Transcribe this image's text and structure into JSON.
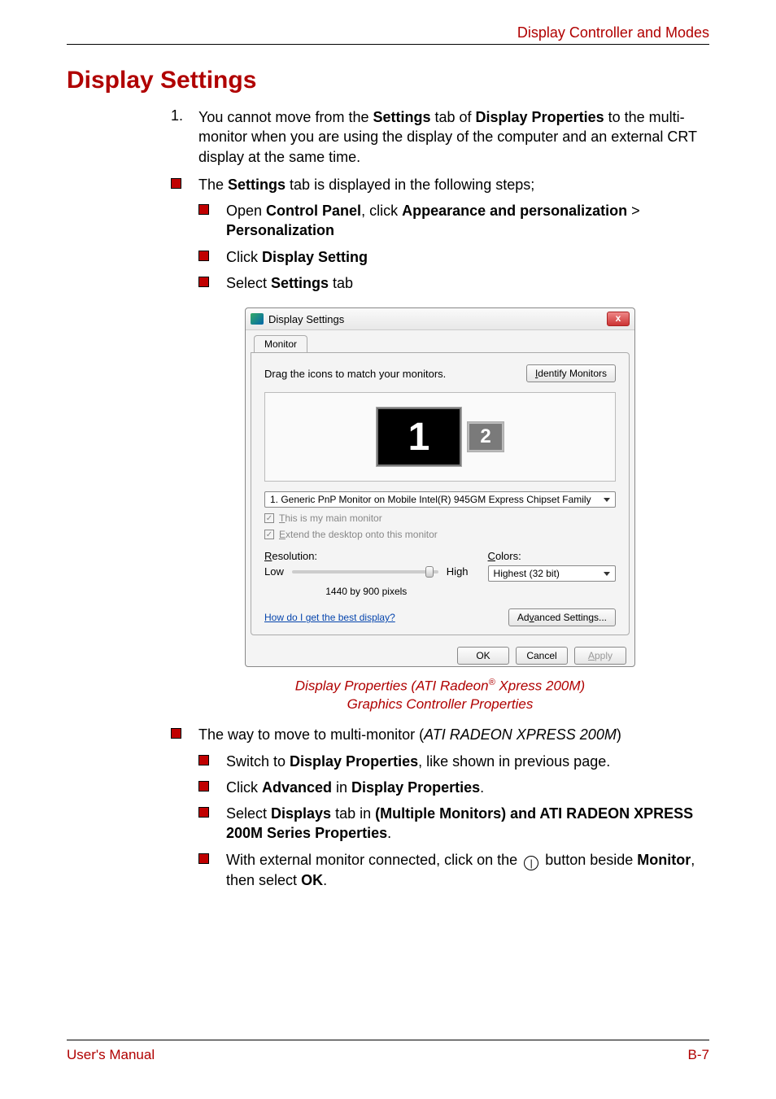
{
  "header": {
    "section_title": "Display Controller and Modes"
  },
  "title": "Display Settings",
  "item1": {
    "num": "1.",
    "p1a": "You cannot move from the ",
    "p1b": "Settings",
    "p1c": " tab of ",
    "p1d": "Display Properties",
    "p1e": " to the multi-monitor when you are using the display of the computer and an external CRT display at the same time."
  },
  "bullet1": {
    "a": "The ",
    "b": "Settings",
    "c": " tab is displayed in the following steps;"
  },
  "sub1": {
    "a": "Open ",
    "b": "Control Panel",
    "c": ", click ",
    "d": "Appearance and personalization",
    "e": " > ",
    "f": "Personalization"
  },
  "sub2": {
    "a": "Click ",
    "b": "Display Setting"
  },
  "sub3": {
    "a": "Select ",
    "b": "Settings",
    "c": " tab"
  },
  "dialog": {
    "title": "Display Settings",
    "close": "x",
    "tab": "Monitor",
    "drag_text": "Drag the icons to match your monitors.",
    "identify": "Identify Monitors",
    "mon1": "1",
    "mon2": "2",
    "monitor_select": "1. Generic PnP Monitor on Mobile Intel(R) 945GM Express Chipset Family",
    "check1_pre": "T",
    "check1_rest": "his is my main monitor",
    "check2_pre": "E",
    "check2_rest": "xtend the desktop onto this monitor",
    "res_label_pre": "R",
    "res_label_rest": "esolution:",
    "colors_label_pre": "C",
    "colors_label_rest": "olors:",
    "low": "Low",
    "high": "High",
    "res_value": "1440 by 900 pixels",
    "color_depth": "Highest (32 bit)",
    "help": "How do I get the best display?",
    "adv_pre": "Ad",
    "adv_u": "v",
    "adv_post": "anced Settings...",
    "ok": "OK",
    "cancel": "Cancel",
    "apply_pre": "A",
    "apply_rest": "pply"
  },
  "caption": {
    "line1a": "Display Properties (ATI Radeon",
    "reg": "®",
    "line1b": " Xpress 200M)",
    "line2": "Graphics Controller Properties"
  },
  "bullet2": {
    "a": "The way to move to multi-monitor (",
    "b": "ATI RADEON XPRESS 200M",
    "c": ")"
  },
  "sub4": {
    "a": "Switch to ",
    "b": "Display Properties",
    "c": ", like shown in previous page."
  },
  "sub5": {
    "a": "Click ",
    "b": "Advanced",
    "c": " in ",
    "d": "Display Properties",
    "e": "."
  },
  "sub6": {
    "a": "Select ",
    "b": "Displays",
    "c": " tab in ",
    "d": "(Multiple Monitors) and ATI RADEON XPRESS 200M Series Properties",
    "e": "."
  },
  "sub7": {
    "a": "With external monitor connected, click on the ",
    "icon": "|",
    "b": " button beside ",
    "c": "Monitor",
    "d": ", then select ",
    "e": "OK",
    "f": "."
  },
  "footer": {
    "left": "User's Manual",
    "right": "B-7"
  }
}
